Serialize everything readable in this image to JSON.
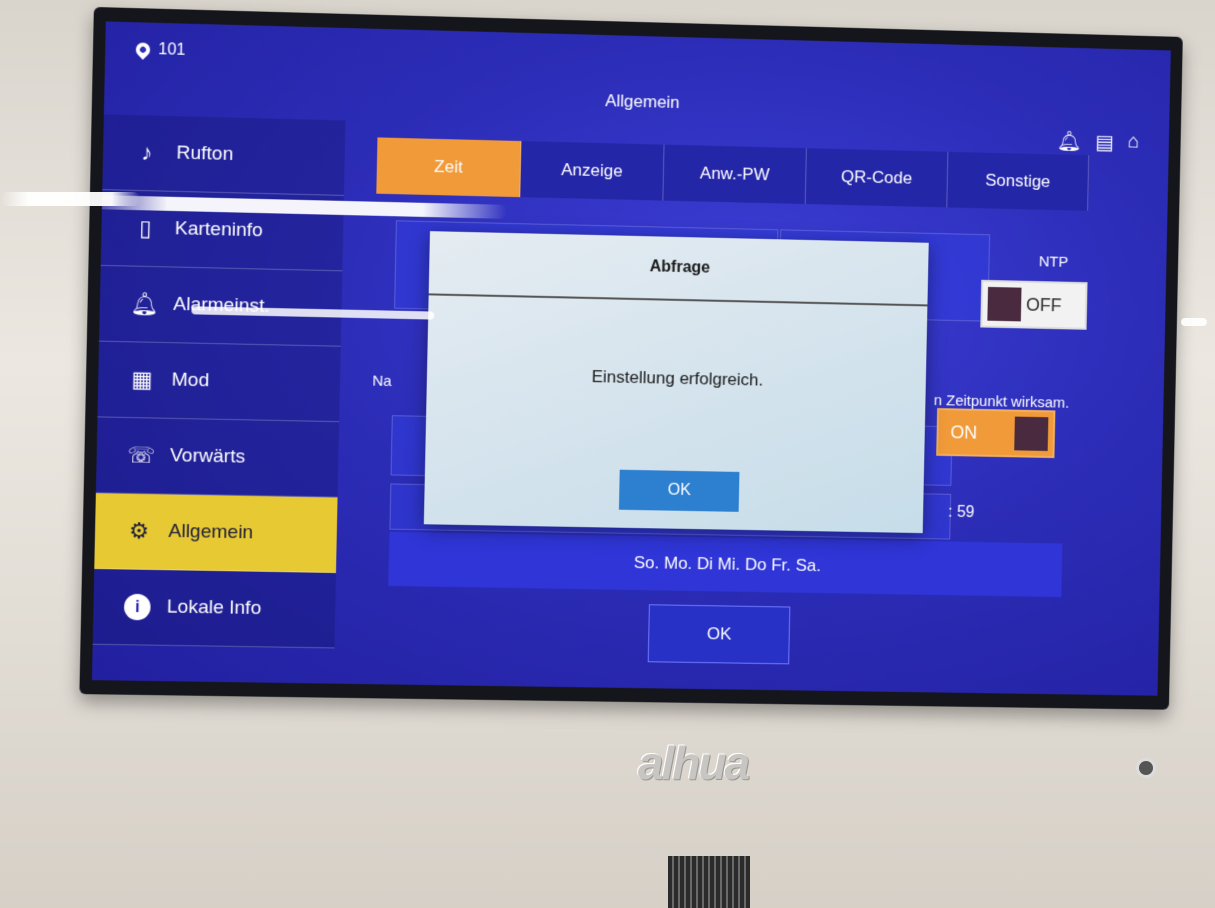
{
  "status": {
    "room": "101"
  },
  "screen_title": "Allgemein",
  "top_icons": [
    "bell-icon",
    "message-icon",
    "home-icon"
  ],
  "sidebar": {
    "items": [
      {
        "label": "Rufton",
        "icon": "music-note-icon"
      },
      {
        "label": "Karteninfo",
        "icon": "card-icon"
      },
      {
        "label": "Alarmeinst.",
        "icon": "alarm-bell-icon"
      },
      {
        "label": "Mod",
        "icon": "grid-icon"
      },
      {
        "label": "Vorwärts",
        "icon": "call-forward-icon"
      },
      {
        "label": "Allgemein",
        "icon": "gear-icon",
        "active": true
      },
      {
        "label": "Lokale Info",
        "icon": "info-icon"
      }
    ]
  },
  "tabs": [
    {
      "label": "Zeit",
      "active": true
    },
    {
      "label": "Anzeige"
    },
    {
      "label": "Anw.-PW"
    },
    {
      "label": "QR-Code"
    },
    {
      "label": "Sonstige"
    }
  ],
  "content": {
    "ntp_label": "NTP",
    "ntp_toggle": "OFF",
    "section_label": "Na",
    "note": "n Zeitpunkt wirksam.",
    "dst_toggle": "ON",
    "time_value": ": 59",
    "days": "So. Mo. Di Mi. Do Fr. Sa.",
    "ok_label": "OK"
  },
  "dialog": {
    "title": "Abfrage",
    "message": "Einstellung erfolgreich.",
    "ok_label": "OK"
  },
  "brand": "alhua",
  "colors": {
    "screen_bg": "#2c2db8",
    "active_tab": "#f09a3a",
    "active_sidebar": "#e7c934",
    "dialog_bg": "#d2e2ec",
    "dialog_button": "#2d7fd0"
  }
}
